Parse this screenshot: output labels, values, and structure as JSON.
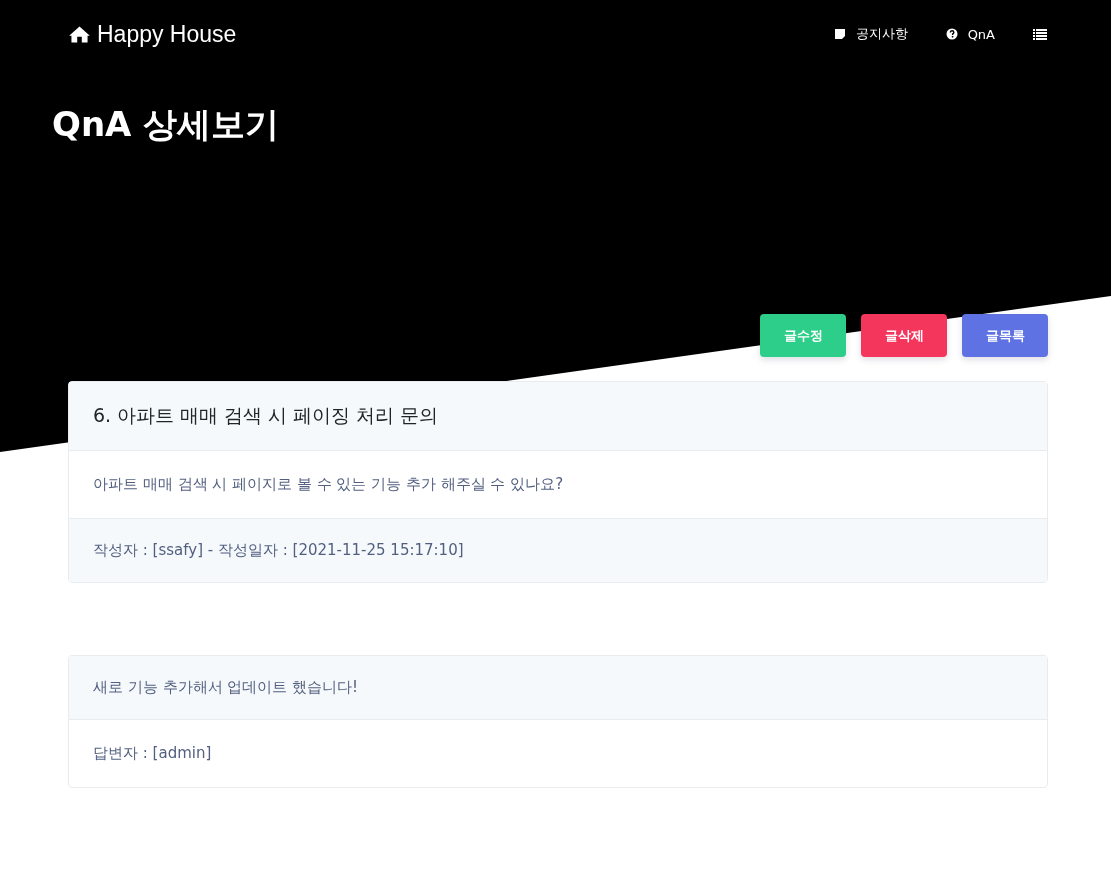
{
  "brand": {
    "title": "Happy House"
  },
  "nav": [
    {
      "label": "공지사항",
      "kind": "notice"
    },
    {
      "label": "QnA",
      "kind": "qna"
    },
    {
      "kind": "menu"
    }
  ],
  "page_title": "QnA 상세보기",
  "actions": [
    {
      "label": "글수정",
      "kind": "edit"
    },
    {
      "label": "글삭제",
      "kind": "delete"
    },
    {
      "label": "글목록",
      "kind": "list"
    }
  ],
  "question": {
    "title": "6. 아파트 매매 검색 시 페이징 처리 문의",
    "body": "아파트 매매 검색 시 페이지로 볼 수 있는 기능 추가 해주실 수 있나요?",
    "meta": "작성자 : [ssafy] - 작성일자 : [2021-11-25 15:17:10]"
  },
  "answer": {
    "body": "새로 기능 추가해서 업데이트 했습니다!",
    "meta": "답변자 : [admin]"
  }
}
